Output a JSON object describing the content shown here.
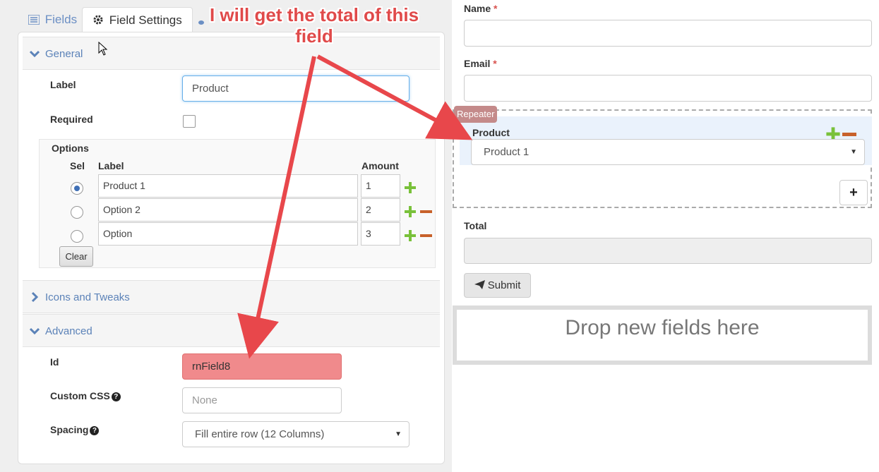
{
  "tabs": [
    {
      "label": "Fields",
      "icon": "list-icon"
    },
    {
      "label": "Field Settings",
      "icon": "gear-icon"
    },
    {
      "label": "",
      "icon": "music-note-icon"
    }
  ],
  "sections": {
    "general": "General",
    "icons_tweaks": "Icons and Tweaks",
    "advanced": "Advanced"
  },
  "general": {
    "label_title": "Label",
    "label_value": "Product",
    "required_title": "Required",
    "required_checked": false,
    "options_title": "Options",
    "col_sel": "Sel",
    "col_label": "Label",
    "col_amount": "Amount",
    "options": [
      {
        "label": "Product 1",
        "amount": "1",
        "selected": true
      },
      {
        "label": "Option 2",
        "amount": "2",
        "selected": false
      },
      {
        "label": "Option",
        "amount": "3",
        "selected": false
      }
    ],
    "clear_label": "Clear"
  },
  "advanced": {
    "id_title": "Id",
    "id_value": "rnField8",
    "css_title": "Custom CSS",
    "css_placeholder": "None",
    "spacing_title": "Spacing",
    "spacing_value": "Fill entire row (12 Columns)"
  },
  "form": {
    "name_label": "Name",
    "email_label": "Email",
    "required_mark": "*",
    "repeater_badge": "Repeater",
    "product_label": "Product",
    "product_value": "Product 1",
    "add_label": "+",
    "total_label": "Total",
    "submit_label": "Submit",
    "drop_text": "Drop new fields here"
  },
  "annotation": {
    "text": "I will get the total of this field",
    "color": "#e8474b"
  }
}
